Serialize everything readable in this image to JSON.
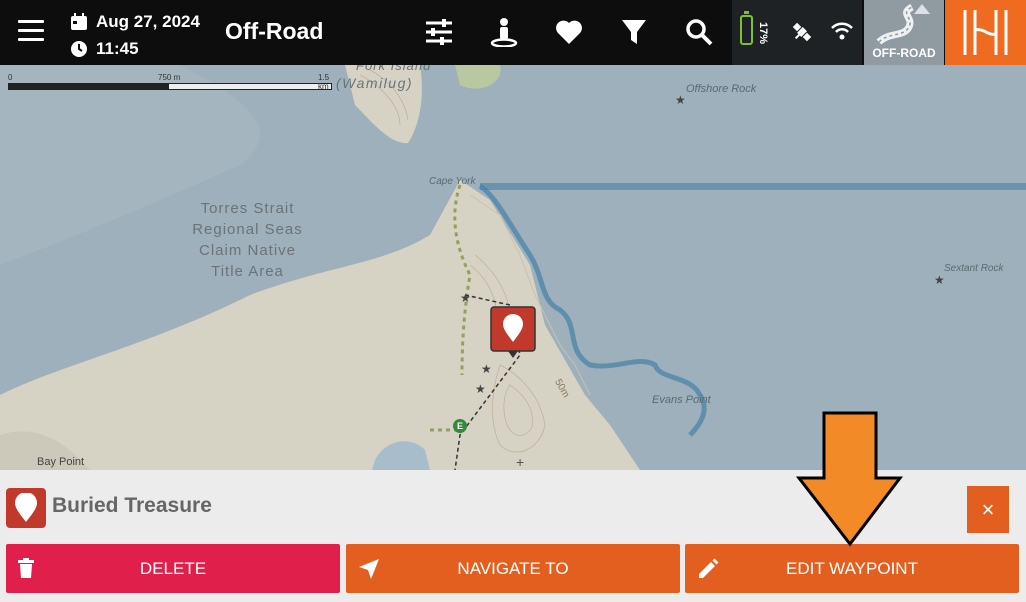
{
  "header": {
    "date": "Aug 27, 2024",
    "time": "11:45",
    "title": "Off-Road",
    "battery_percent": "17%",
    "mode_label": "OFF-ROAD"
  },
  "map": {
    "scale": {
      "zero": "0",
      "mid": "750 m",
      "end": "1.5 km"
    },
    "labels": {
      "fork_island": "Fork Island",
      "wamilug": "(Wamilug)",
      "offshore_rock": "Offshore Rock",
      "cape_york": "Cape York",
      "sextant_rock": "Sextant Rock",
      "evans_point": "Evans Point",
      "bay_point": "Bay Point",
      "contour": "50m",
      "marker_e": "E"
    },
    "region_lines": [
      "Torres Strait",
      "Regional Seas",
      "Claim Native",
      "Title Area"
    ]
  },
  "waypoint": {
    "name": "Buried Treasure",
    "close": "×",
    "actions": {
      "delete": "DELETE",
      "navigate": "NAVIGATE TO",
      "edit": "EDIT WAYPOINT"
    }
  },
  "colors": {
    "topbar": "#0d0d0d",
    "accent": "#e35f20",
    "delete": "#e0204a",
    "waypoint": "#c0392b",
    "water": "#9db0bb",
    "land": "#d6d2c4",
    "track": "#3d7ea6"
  }
}
